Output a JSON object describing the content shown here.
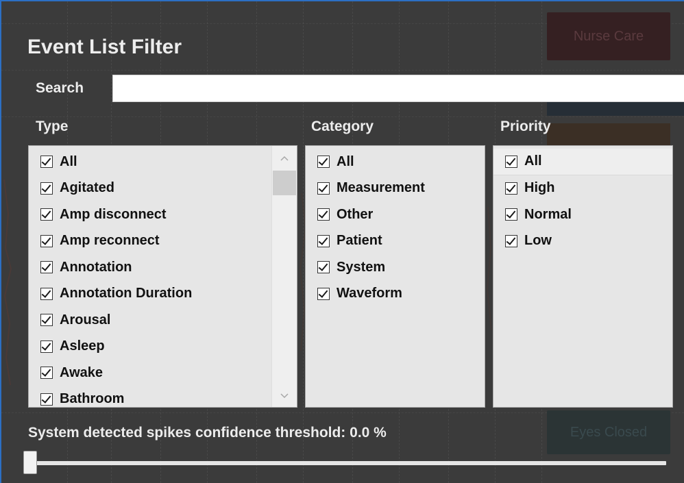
{
  "dialog": {
    "title": "Event List Filter"
  },
  "search": {
    "label": "Search",
    "value": "",
    "placeholder": ""
  },
  "type": {
    "heading": "Type",
    "items": [
      {
        "label": "All",
        "checked": true
      },
      {
        "label": "Agitated",
        "checked": true
      },
      {
        "label": "Amp disconnect",
        "checked": true
      },
      {
        "label": "Amp reconnect",
        "checked": true
      },
      {
        "label": "Annotation",
        "checked": true
      },
      {
        "label": "Annotation Duration",
        "checked": true
      },
      {
        "label": "Arousal",
        "checked": true
      },
      {
        "label": "Asleep",
        "checked": true
      },
      {
        "label": "Awake",
        "checked": true
      },
      {
        "label": "Bathroom",
        "checked": true
      }
    ]
  },
  "category": {
    "heading": "Category",
    "items": [
      {
        "label": "All",
        "checked": true
      },
      {
        "label": "Measurement",
        "checked": true
      },
      {
        "label": "Other",
        "checked": true
      },
      {
        "label": "Patient",
        "checked": true
      },
      {
        "label": "System",
        "checked": true
      },
      {
        "label": "Waveform",
        "checked": true
      }
    ]
  },
  "priority": {
    "heading": "Priority",
    "items": [
      {
        "label": "All",
        "checked": true
      },
      {
        "label": "High",
        "checked": true
      },
      {
        "label": "Normal",
        "checked": true
      },
      {
        "label": "Low",
        "checked": true
      }
    ]
  },
  "threshold": {
    "label": "System detected spikes confidence threshold: 0.0 %",
    "value_percent": 0.0
  },
  "background": {
    "nurse_care_label": "Nurse Care",
    "eyes_closed_label": "Eyes Closed"
  },
  "icons": {
    "scroll_up": "chevron-up-icon",
    "scroll_down": "chevron-down-icon",
    "checkbox": "checkmark-icon"
  },
  "colors": {
    "dialog_bg": "#3b3b3b",
    "window_border": "#2c6fc4",
    "list_bg": "#e6e6e6"
  }
}
